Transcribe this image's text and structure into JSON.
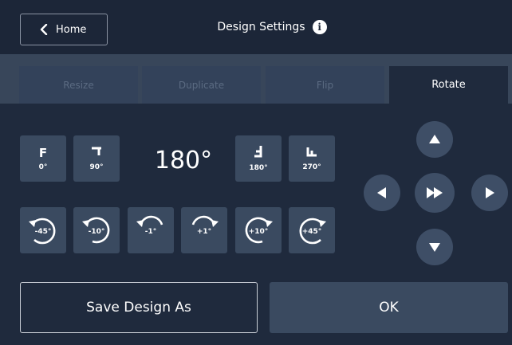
{
  "header": {
    "back_label": "Home",
    "title": "Design Settings",
    "info_glyph": "i"
  },
  "tabs": [
    {
      "label": "Resize",
      "active": false
    },
    {
      "label": "Duplicate",
      "active": false
    },
    {
      "label": "Flip",
      "active": false
    },
    {
      "label": "Rotate",
      "active": true
    }
  ],
  "presets": [
    {
      "glyph": "F",
      "label": "0°"
    },
    {
      "glyph": "ℸ",
      "label": "90°"
    },
    {
      "glyph": "Ⅎ",
      "label": "180°"
    },
    {
      "glyph": "Ш",
      "label": "270°"
    }
  ],
  "current_angle": "180°",
  "rotate_steps": [
    {
      "label": "-45°",
      "direction": "counterclockwise"
    },
    {
      "label": "-10°",
      "direction": "counterclockwise"
    },
    {
      "label": "-1°",
      "direction": "counterclockwise"
    },
    {
      "label": "+1°",
      "direction": "clockwise"
    },
    {
      "label": "+10°",
      "direction": "clockwise"
    },
    {
      "label": "+45°",
      "direction": "clockwise"
    }
  ],
  "dpad": {
    "up": "arrow-up-icon",
    "left": "arrow-left-icon",
    "center": "fast-forward-icon",
    "right": "arrow-right-icon",
    "down": "arrow-down-icon"
  },
  "footer": {
    "save_label": "Save Design As",
    "ok_label": "OK"
  },
  "colors": {
    "background": "#1f2a3d",
    "button": "#3a4a60",
    "tab_inactive_text": "#5b6b82"
  }
}
